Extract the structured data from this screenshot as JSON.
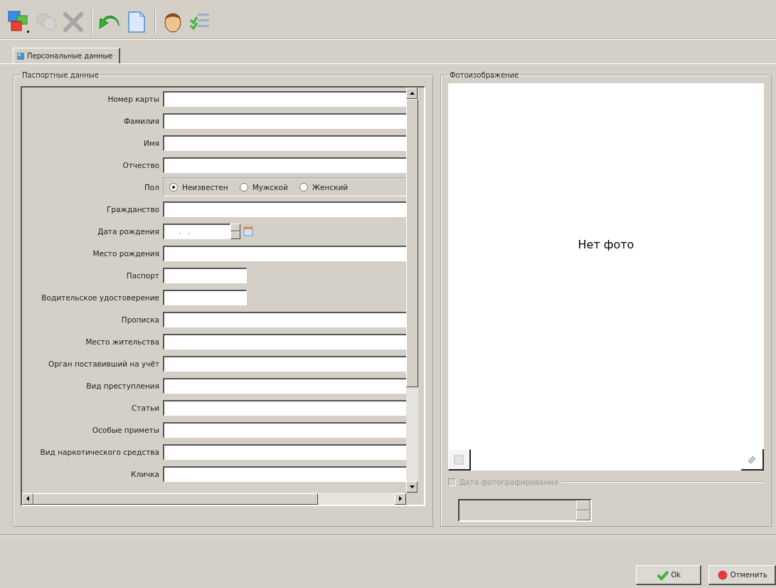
{
  "toolbar": {
    "buttons": [
      {
        "kind": "windows",
        "disabled": false
      },
      {
        "kind": "person",
        "disabled": true
      },
      {
        "kind": "delete",
        "disabled": true
      },
      {
        "kind": "separator"
      },
      {
        "kind": "undo",
        "disabled": false
      },
      {
        "kind": "document",
        "disabled": false
      },
      {
        "kind": "separator"
      },
      {
        "kind": "face",
        "disabled": false
      },
      {
        "kind": "checklist",
        "disabled": false
      }
    ]
  },
  "tabs": [
    {
      "label": "Персональные данные",
      "selected": true
    }
  ],
  "passport_group": {
    "title": "Паспортные данные",
    "fields": [
      {
        "kind": "text",
        "label": "Номер карты"
      },
      {
        "kind": "text",
        "label": "Фамилия"
      },
      {
        "kind": "text",
        "label": "Имя"
      },
      {
        "kind": "text",
        "label": "Отчество"
      },
      {
        "kind": "radio",
        "label": "Пол",
        "options": [
          {
            "label": "Неизвестен",
            "selected": true
          },
          {
            "label": "Мужской",
            "selected": false
          },
          {
            "label": "Женский",
            "selected": false
          }
        ]
      },
      {
        "kind": "text",
        "label": "Гражданство"
      },
      {
        "kind": "date",
        "label": "Дата рождения",
        "value": ".  ."
      },
      {
        "kind": "text",
        "label": "Место рождения"
      },
      {
        "kind": "short",
        "label": "Паспорт"
      },
      {
        "kind": "short",
        "label": "Водительское удостоверение"
      },
      {
        "kind": "text",
        "label": "Прописка"
      },
      {
        "kind": "text",
        "label": "Место жительства"
      },
      {
        "kind": "text",
        "label": "Орган поставивший на учёт"
      },
      {
        "kind": "text",
        "label": "Вид преступления"
      },
      {
        "kind": "text",
        "label": "Статьи"
      },
      {
        "kind": "text",
        "label": "Особые приметы"
      },
      {
        "kind": "text",
        "label": "Вид наркотического средства"
      },
      {
        "kind": "text",
        "label": "Кличка"
      }
    ]
  },
  "photo_group": {
    "title": "Фотоизображение",
    "empty_text": "Нет фото",
    "photo_date": {
      "label": "Дата фотографирования",
      "checked": false,
      "disabled": true
    }
  },
  "buttons": [
    {
      "kind": "ok",
      "label": "Ok"
    },
    {
      "kind": "cancel",
      "label": "Отменить"
    }
  ]
}
